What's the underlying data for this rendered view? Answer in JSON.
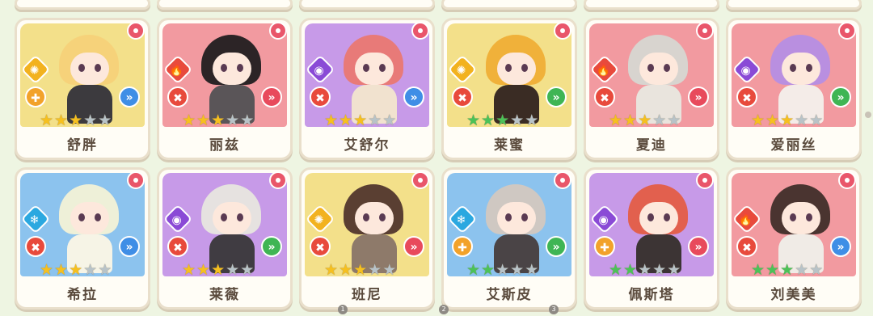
{
  "rows": [
    [
      {
        "name": "舒胖",
        "bg": "yellow",
        "element": "light",
        "role": "support",
        "chev": "blue",
        "stars": [
          "gold",
          "gold",
          "gold",
          "empty",
          "empty"
        ],
        "hair": "#f6d27a",
        "outfit": "#3c3a3e"
      },
      {
        "name": "丽兹",
        "bg": "red",
        "element": "fire",
        "role": "attack",
        "chev": "red",
        "stars": [
          "gold",
          "gold",
          "gold",
          "empty",
          "empty"
        ],
        "hair": "#2c2426",
        "outfit": "#5a5558"
      },
      {
        "name": "艾舒尔",
        "bg": "purple",
        "element": "dark",
        "role": "attack",
        "chev": "blue",
        "stars": [
          "gold",
          "gold",
          "gold",
          "empty",
          "empty"
        ],
        "hair": "#e87a78",
        "outfit": "#f1e2cf"
      },
      {
        "name": "莱蜜",
        "bg": "yellow",
        "element": "light",
        "role": "attack",
        "chev": "green",
        "stars": [
          "green",
          "green",
          "green",
          "empty",
          "empty"
        ],
        "hair": "#f0b13a",
        "outfit": "#3a2c24"
      },
      {
        "name": "夏迪",
        "bg": "red",
        "element": "fire",
        "role": "attack",
        "chev": "red",
        "stars": [
          "gold",
          "gold",
          "gold",
          "empty",
          "empty"
        ],
        "hair": "#d8d4cf",
        "outfit": "#e9e4dd"
      },
      {
        "name": "爱丽丝",
        "bg": "red",
        "element": "dark",
        "role": "attack",
        "chev": "green",
        "stars": [
          "gold",
          "gold",
          "gold",
          "empty",
          "empty"
        ],
        "hair": "#b98fe0",
        "outfit": "#f4ece8"
      }
    ],
    [
      {
        "name": "希拉",
        "bg": "blue",
        "element": "ice",
        "role": "attack",
        "chev": "blue",
        "stars": [
          "gold",
          "gold",
          "gold",
          "empty",
          "empty"
        ],
        "hair": "#eef0d8",
        "outfit": "#f6f4e6"
      },
      {
        "name": "莱薇",
        "bg": "purple",
        "element": "dark",
        "role": "attack",
        "chev": "green",
        "stars": [
          "gold",
          "gold",
          "gold",
          "empty",
          "empty"
        ],
        "hair": "#e6e2e0",
        "outfit": "#403c42"
      },
      {
        "name": "班尼",
        "bg": "yellow",
        "element": "light",
        "role": "attack",
        "chev": "red",
        "stars": [
          "gold",
          "gold",
          "gold",
          "empty",
          "empty"
        ],
        "hair": "#5a3f32",
        "outfit": "#8e7a6a"
      },
      {
        "name": "艾斯皮",
        "bg": "blue",
        "element": "ice",
        "role": "support",
        "chev": "green",
        "stars": [
          "green",
          "green",
          "empty",
          "empty",
          "empty"
        ],
        "hair": "#cfc8c2",
        "outfit": "#4a4446"
      },
      {
        "name": "佩斯塔",
        "bg": "purple",
        "element": "dark",
        "role": "support",
        "chev": "red",
        "stars": [
          "green",
          "green",
          "empty",
          "empty",
          "empty"
        ],
        "hair": "#e2604e",
        "outfit": "#3c3434"
      },
      {
        "name": "刘美美",
        "bg": "red",
        "element": "fire",
        "role": "attack",
        "chev": "blue",
        "stars": [
          "green",
          "green",
          "green",
          "empty",
          "empty"
        ],
        "hair": "#4a3430",
        "outfit": "#f0ebe6"
      }
    ]
  ],
  "icons": {
    "element": {
      "fire": "🔥",
      "light": "✺",
      "dark": "◉",
      "ice": "❄"
    },
    "role": {
      "attack": "✖",
      "support": "✚"
    },
    "chev": "»",
    "star": "★"
  },
  "page_dots": [
    "1",
    "2",
    "3"
  ],
  "colors": {
    "gold_star": "#f6c01f",
    "green_star": "#4cc258",
    "empty_star": "#b8c3c8",
    "flower": "#e9566a"
  }
}
